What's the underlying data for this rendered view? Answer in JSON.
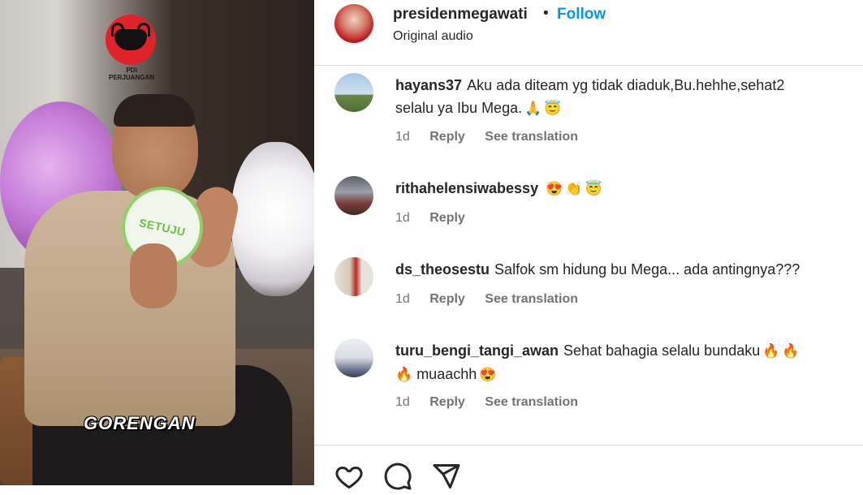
{
  "video": {
    "logo_text_1": "PDI",
    "logo_text_2": "PERJUANGAN",
    "paddle_text": "SETUJU",
    "watermark": "GORENGAN"
  },
  "header": {
    "username": "presidenmegawati",
    "separator": "•",
    "follow_label": "Follow",
    "audio": "Original audio"
  },
  "comments": [
    {
      "username": "hayans37",
      "text_line1": "Aku ada diteam yg tidak diaduk,Bu.hehhe,sehat2",
      "text_line2": "selalu ya Ibu Mega.",
      "emojis": [
        "🙏",
        "😇"
      ],
      "time": "1d",
      "reply": "Reply",
      "translation": "See translation"
    },
    {
      "username": "rithahelensiwabessy",
      "text": "",
      "emojis": [
        "😍",
        "👏",
        "😇"
      ],
      "time": "1d",
      "reply": "Reply"
    },
    {
      "username": "ds_theosestu",
      "text": "Salfok sm hidung bu Mega... ada antingnya???",
      "time": "1d",
      "reply": "Reply",
      "translation": "See translation"
    },
    {
      "username": "turu_bengi_tangi_awan",
      "text_line1": "Sehat bahagia selalu bundaku",
      "text_line2": "muaachh",
      "emojis_line1": [
        "🔥",
        "🔥"
      ],
      "emojis_line2_pre": [
        "🔥"
      ],
      "emojis_line2_post": [
        "😍"
      ],
      "time": "1d",
      "reply": "Reply",
      "translation": "See translation"
    }
  ],
  "footer": {
    "icons": [
      "heart-icon",
      "comment-icon",
      "share-icon"
    ]
  },
  "colors": {
    "link": "#0095f6",
    "text": "#262626",
    "muted": "#737373",
    "border": "#dbdbdb"
  }
}
